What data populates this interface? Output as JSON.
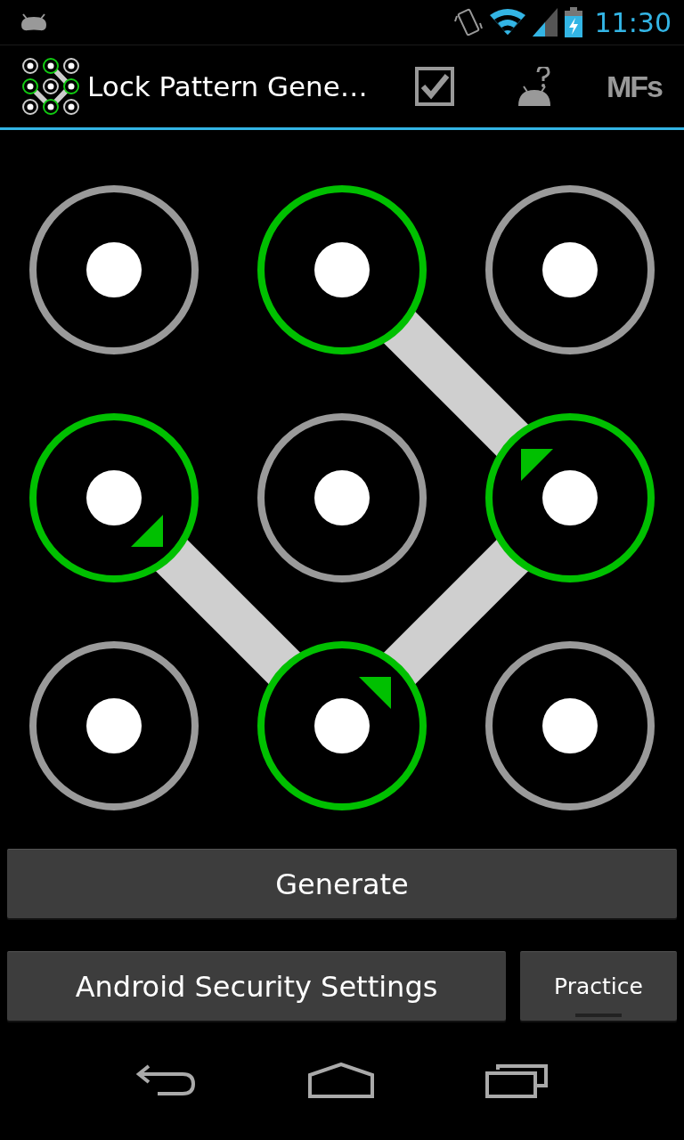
{
  "status_bar": {
    "time": "11:30"
  },
  "action_bar": {
    "title": "Lock Pattern Gene…",
    "actions": [
      {
        "kind": "check"
      },
      {
        "kind": "help"
      },
      {
        "kind": "logo",
        "text": "MFs"
      }
    ]
  },
  "pattern": {
    "cells": [
      {
        "selected": false,
        "kind": "plain"
      },
      {
        "selected": true,
        "kind": "plain"
      },
      {
        "selected": false,
        "kind": "plain"
      },
      {
        "selected": true,
        "kind": "downright"
      },
      {
        "selected": false,
        "kind": "plain"
      },
      {
        "selected": true,
        "kind": "upleft"
      },
      {
        "selected": false,
        "kind": "plain"
      },
      {
        "selected": true,
        "kind": "upright"
      },
      {
        "selected": false,
        "kind": "plain"
      }
    ]
  },
  "buttons": {
    "generate": "Generate",
    "security": "Android Security Settings",
    "practice": "Practice"
  }
}
